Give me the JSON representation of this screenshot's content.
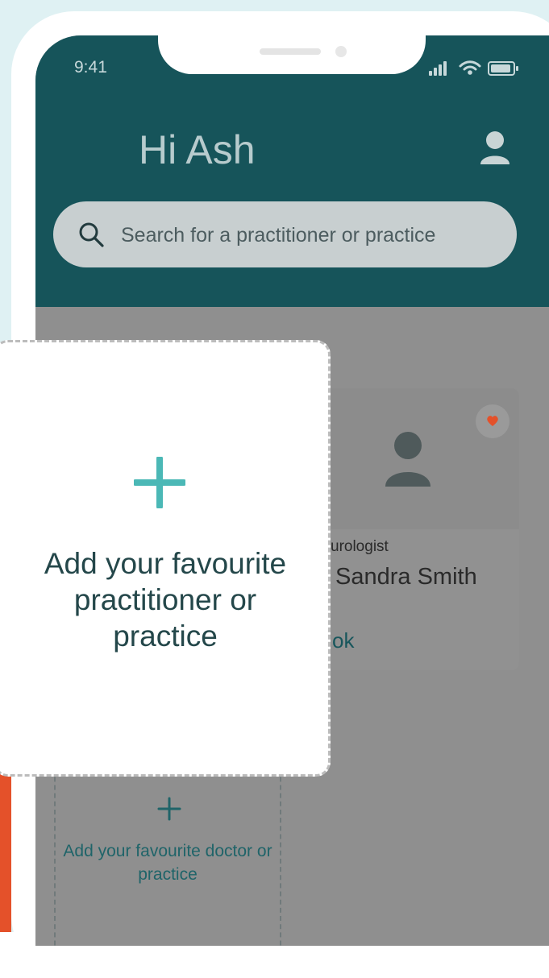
{
  "status": {
    "time": "9:41"
  },
  "header": {
    "greeting": "Hi Ash"
  },
  "search": {
    "placeholder": "Search for a practitioner or practice"
  },
  "favourite_card": {
    "specialty": "urologist",
    "name": "Sandra Smith",
    "action": "ok"
  },
  "background_add": {
    "label": "Add your favourite doctor or practice"
  },
  "add_panel": {
    "title": "Add your favourite practitioner or practice"
  },
  "colors": {
    "header": "#16545a",
    "accent": "#4bb8b6",
    "favorite": "#e4512a",
    "frame_bg": "#dff1f3"
  }
}
